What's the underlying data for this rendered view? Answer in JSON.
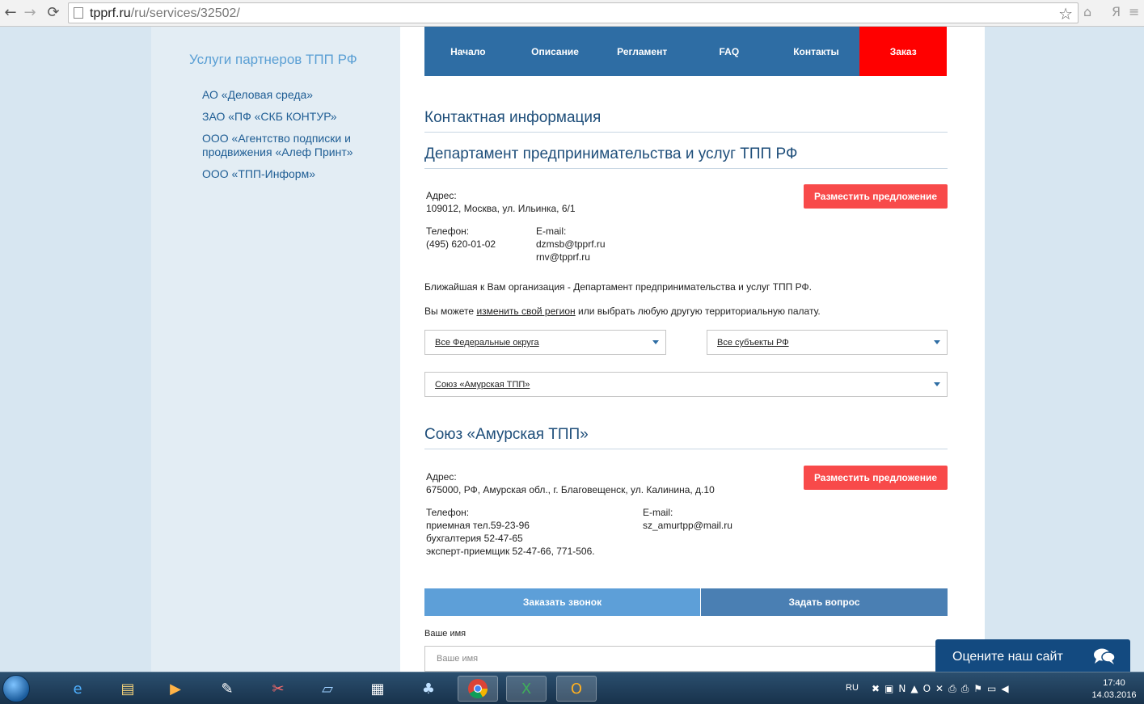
{
  "browser": {
    "url_host": "tpprf.ru",
    "url_path": "/ru/services/32502/",
    "back_icon": "arrow-left",
    "forward_icon": "arrow-right",
    "reload_icon": "reload",
    "bookmark_icon": "star",
    "right_letter": "Я"
  },
  "sidebar": {
    "title": "Услуги партнеров ТПП РФ",
    "links": [
      "АО «Деловая среда»",
      "ЗАО «ПФ «СКБ КОНТУР»",
      "ООО «Агентство подписки и продвижения «Алеф Принт»",
      "ООО «ТПП-Информ»"
    ]
  },
  "topnav": [
    "Начало",
    "Описание",
    "Регламент",
    "FAQ",
    "Контакты",
    "Заказ"
  ],
  "contact": {
    "heading": "Контактная информация",
    "department": "Департамент предпринимательства и услуг ТПП РФ",
    "address_label": "Адрес:",
    "address": "109012, Москва, ул. Ильинка, 6/1",
    "phone_label": "Телефон:",
    "phone": "(495) 620-01-02",
    "email_label": "E-mail:",
    "emails": [
      "dzmsb@tpprf.ru",
      "rnv@tpprf.ru"
    ],
    "offer_button": "Разместить предложение",
    "nearest": "Ближайшая к Вам организация - Департамент предпринимательства и услуг ТПП РФ.",
    "region_pre": "Вы можете ",
    "region_link": "изменить свой регион",
    "region_post": " или выбрать любую другую территориальную палату.",
    "select_districts": "Все Федеральные округа",
    "select_subjects": "Все субъекты РФ",
    "select_chamber": "Союз «Амурская ТПП»"
  },
  "chamber": {
    "heading": "Союз «Амурская ТПП»",
    "address_label": "Адрес:",
    "address": "675000, РФ, Амурская обл., г. Благовещенск, ул. Калинина, д.10",
    "phone_label": "Телефон:",
    "phones": [
      "приемная тел.59-23-96",
      "бухгалтерия 52-47-65",
      "эксперт-приемщик 52-47-66, 771-506."
    ],
    "email_label": "E-mail:",
    "email": "sz_amurtpp@mail.ru",
    "offer_button": "Разместить предложение"
  },
  "form": {
    "tab_call": "Заказать звонок",
    "tab_question": "Задать вопрос",
    "name_label": "Ваше имя",
    "name_placeholder": "Ваше имя"
  },
  "rate_widget": {
    "label": "Оцените наш сайт",
    "icon": "chat-bubbles"
  },
  "taskbar": {
    "apps": [
      "internet-explorer",
      "file-explorer",
      "media-player",
      "paint",
      "snipping-tool",
      "notepad",
      "calculator",
      "app",
      "chrome",
      "excel",
      "outlook"
    ],
    "active_app": "chrome",
    "lang": "RU",
    "time": "17:40",
    "date": "14.03.2016"
  },
  "colors": {
    "nav_blue": "#2e6da4",
    "order_red": "#ff0000",
    "button_red": "#f84a4a",
    "tab_light": "#5d9fd8",
    "tab_dark": "#4a7fb3",
    "widget_navy": "#134a80"
  }
}
